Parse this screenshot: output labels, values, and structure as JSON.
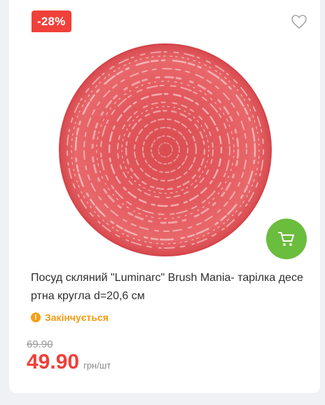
{
  "product": {
    "discount_badge": "-28%",
    "favorite_icon": "heart-outline-icon",
    "cart_icon": "shopping-cart-icon",
    "image_alt": "red round glass dessert plate",
    "title": "Посуд скляний \"Luminarc\" Brush Mania- тарілка десертна кругла d=20,6 см",
    "status_icon": "exclamation-circle-icon",
    "status": "Закінчується",
    "old_price": "69.90",
    "price": "49.90",
    "unit": "грн/шт"
  },
  "colors": {
    "badge": "#f0403a",
    "cart_button": "#6bbd3d",
    "status": "#f59a12",
    "price": "#f0403a"
  }
}
